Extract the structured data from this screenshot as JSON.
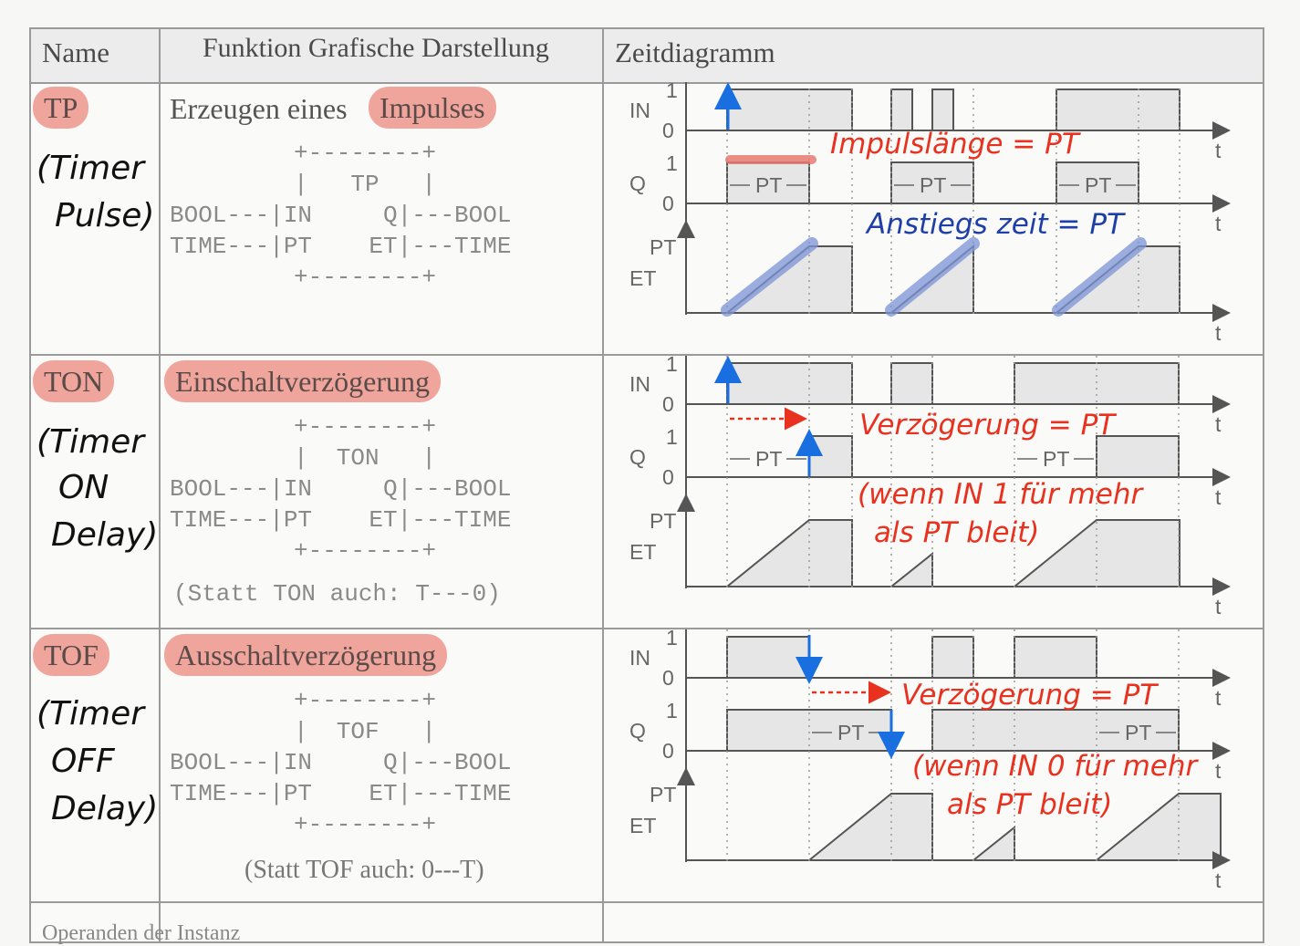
{
  "header": {
    "name": "Name",
    "function": "Funktion Grafische Darstellung",
    "timing": "Zeitdiagramm"
  },
  "rows": [
    {
      "tag": "TP",
      "hand": [
        "(Timer",
        "Pulse)"
      ],
      "function_text": "Erzeugen eines",
      "function_pill": "Impulses",
      "block": [
        "+--------+",
        "|   TP   |",
        "BOOL---|IN     Q|---BOOL",
        "TIME---|PT    ET|---TIME",
        "+--------+"
      ],
      "statement": "",
      "note_1": "Impulslänge = PT",
      "note_2": "Anstiegs zeit = PT"
    },
    {
      "tag": "TON",
      "hand": [
        "(Timer",
        "ON",
        "Delay)"
      ],
      "function_text": "",
      "function_pill": "Einschaltverzögerung",
      "block": [
        "+--------+",
        "|  TON   |",
        "BOOL---|IN     Q|---BOOL",
        "TIME---|PT    ET|---TIME",
        "+--------+"
      ],
      "statement": "(Statt TON auch: T---0)",
      "note_1": "Verzögerung = PT",
      "note_2": "(wenn IN 1 für mehr",
      "note_3": "als PT bleit)"
    },
    {
      "tag": "TOF",
      "hand": [
        "(Timer",
        "OFF",
        "Delay)"
      ],
      "function_text": "",
      "function_pill": "Ausschaltverzögerung",
      "block": [
        "+--------+",
        "|  TOF   |",
        "BOOL---|IN     Q|---BOOL",
        "TIME---|PT    ET|---TIME",
        "+--------+"
      ],
      "statement": "(Statt TOF auch: 0---T)",
      "note_1": "Verzögerung = PT",
      "note_2": "(wenn IN 0 für mehr",
      "note_3": "als PT bleit)"
    }
  ],
  "axis_labels": {
    "in": "IN",
    "q": "Q",
    "pt": "PT",
    "et": "ET",
    "t": "t",
    "one": "1",
    "zero": "0",
    "pt_marker": "PT"
  },
  "footer_partial": "Operanden der Instanz",
  "colors": {
    "highlight_red": "#f0a59c",
    "note_red": "#e8311f",
    "note_blue": "#1f3fa8",
    "arrow_blue": "#1a6fe0",
    "stroke_blue": "#7c93d6"
  }
}
